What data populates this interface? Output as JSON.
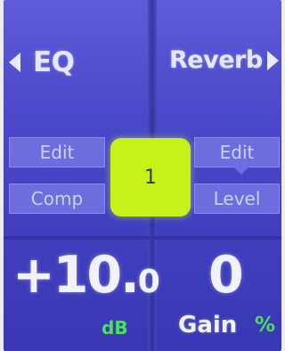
{
  "nav": {
    "left_label": "EQ",
    "right_label": "Reverb"
  },
  "buttons": {
    "edit_left": "Edit",
    "comp": "Comp",
    "edit_right": "Edit",
    "level": "Level"
  },
  "selector": {
    "value": "1"
  },
  "readouts": {
    "left_main": "+10.",
    "left_decimal": "0",
    "left_unit": "dB",
    "right_main": "0",
    "right_label": "Gain",
    "right_unit": "%"
  },
  "colors": {
    "background": "#4848c9",
    "button": "#6d6de0",
    "selector": "#c6f218",
    "unit_accent": "#4ee05a"
  },
  "icons": {
    "left_arrow": "triangle-left",
    "right_arrow": "triangle-right"
  }
}
